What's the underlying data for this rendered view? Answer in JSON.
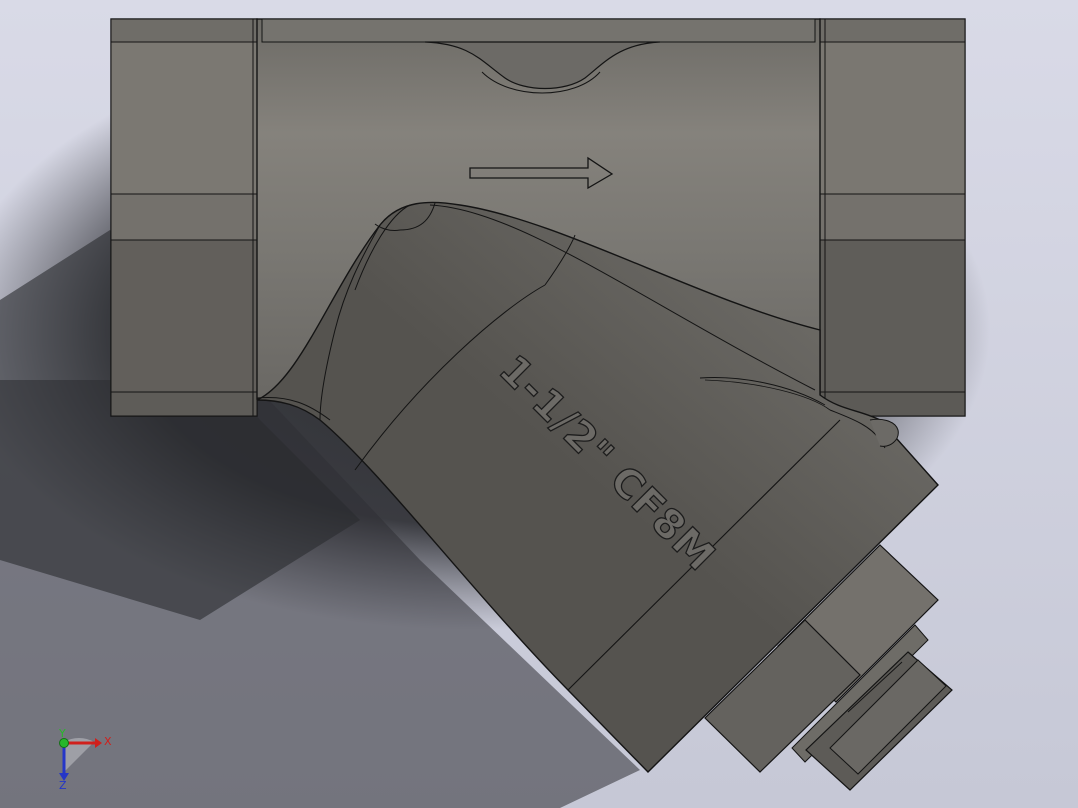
{
  "model": {
    "engraving": "1-1/2\" CF8M"
  },
  "triad": {
    "x_label": "X",
    "y_label": "Y",
    "z_label": "Z",
    "colors": {
      "x": "#d0201c",
      "y": "#27b82a",
      "z": "#2536c8"
    }
  },
  "colors": {
    "background_top": "#d7d8e6",
    "background_bottom": "#c8cad8",
    "shadow": "#2e2f33",
    "body": "#787670",
    "body_light": "#8a8782",
    "end_face": "#737069",
    "end_face_dark": "#5f5d58",
    "edge": "#141414"
  }
}
